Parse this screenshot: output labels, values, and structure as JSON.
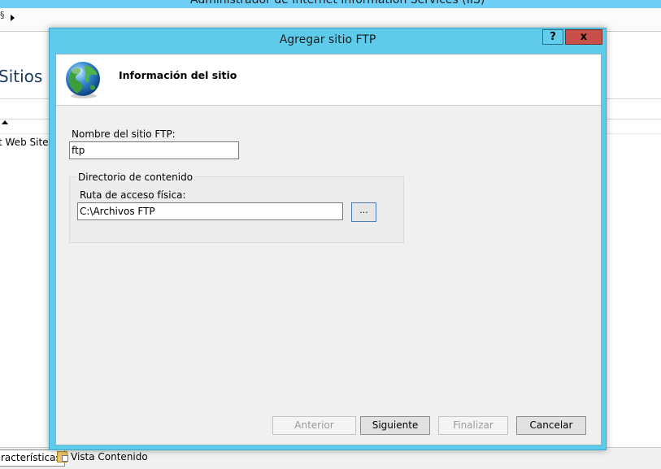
{
  "background_window": {
    "title": "Administrador de Internet Information Services (IIS)",
    "nav_separator": "§",
    "sites_heading": "Sitios",
    "site_item": "t Web Site",
    "status_tabs": {
      "features": "racterísticas",
      "content": "Vista Contenido"
    }
  },
  "dialog": {
    "title": "Agregar sitio FTP",
    "help_label": "?",
    "close_label": "x",
    "header_title": "Información del sitio",
    "site_name_label": "Nombre del sitio FTP:",
    "site_name_value": "ftp",
    "group_title": "Directorio de contenido",
    "path_label": "Ruta de acceso física:",
    "path_value": "C:\\Archivos FTP",
    "browse_label": "...",
    "buttons": {
      "previous": "Anterior",
      "next": "Siguiente",
      "finish": "Finalizar",
      "cancel": "Cancelar"
    }
  },
  "colors": {
    "dialog_frame": "#5ecbea",
    "close_button": "#c9504a",
    "client_bg": "#f0f0f0"
  }
}
